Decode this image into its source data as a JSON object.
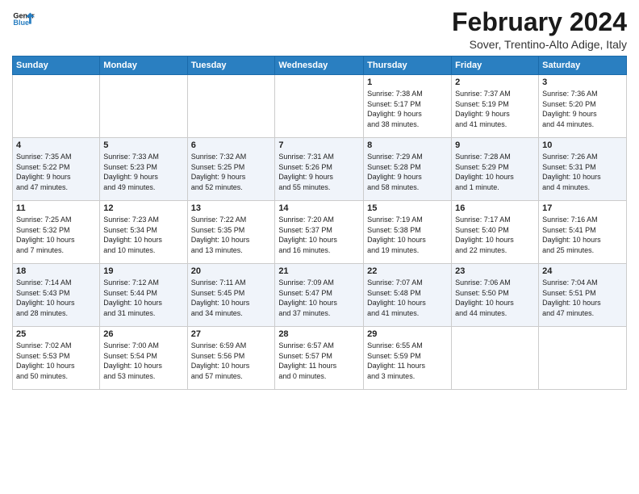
{
  "header": {
    "logo_line1": "General",
    "logo_line2": "Blue",
    "title": "February 2024",
    "subtitle": "Sover, Trentino-Alto Adige, Italy"
  },
  "days_of_week": [
    "Sunday",
    "Monday",
    "Tuesday",
    "Wednesday",
    "Thursday",
    "Friday",
    "Saturday"
  ],
  "weeks": [
    [
      {
        "day": "",
        "info": ""
      },
      {
        "day": "",
        "info": ""
      },
      {
        "day": "",
        "info": ""
      },
      {
        "day": "",
        "info": ""
      },
      {
        "day": "1",
        "info": "Sunrise: 7:38 AM\nSunset: 5:17 PM\nDaylight: 9 hours\nand 38 minutes."
      },
      {
        "day": "2",
        "info": "Sunrise: 7:37 AM\nSunset: 5:19 PM\nDaylight: 9 hours\nand 41 minutes."
      },
      {
        "day": "3",
        "info": "Sunrise: 7:36 AM\nSunset: 5:20 PM\nDaylight: 9 hours\nand 44 minutes."
      }
    ],
    [
      {
        "day": "4",
        "info": "Sunrise: 7:35 AM\nSunset: 5:22 PM\nDaylight: 9 hours\nand 47 minutes."
      },
      {
        "day": "5",
        "info": "Sunrise: 7:33 AM\nSunset: 5:23 PM\nDaylight: 9 hours\nand 49 minutes."
      },
      {
        "day": "6",
        "info": "Sunrise: 7:32 AM\nSunset: 5:25 PM\nDaylight: 9 hours\nand 52 minutes."
      },
      {
        "day": "7",
        "info": "Sunrise: 7:31 AM\nSunset: 5:26 PM\nDaylight: 9 hours\nand 55 minutes."
      },
      {
        "day": "8",
        "info": "Sunrise: 7:29 AM\nSunset: 5:28 PM\nDaylight: 9 hours\nand 58 minutes."
      },
      {
        "day": "9",
        "info": "Sunrise: 7:28 AM\nSunset: 5:29 PM\nDaylight: 10 hours\nand 1 minute."
      },
      {
        "day": "10",
        "info": "Sunrise: 7:26 AM\nSunset: 5:31 PM\nDaylight: 10 hours\nand 4 minutes."
      }
    ],
    [
      {
        "day": "11",
        "info": "Sunrise: 7:25 AM\nSunset: 5:32 PM\nDaylight: 10 hours\nand 7 minutes."
      },
      {
        "day": "12",
        "info": "Sunrise: 7:23 AM\nSunset: 5:34 PM\nDaylight: 10 hours\nand 10 minutes."
      },
      {
        "day": "13",
        "info": "Sunrise: 7:22 AM\nSunset: 5:35 PM\nDaylight: 10 hours\nand 13 minutes."
      },
      {
        "day": "14",
        "info": "Sunrise: 7:20 AM\nSunset: 5:37 PM\nDaylight: 10 hours\nand 16 minutes."
      },
      {
        "day": "15",
        "info": "Sunrise: 7:19 AM\nSunset: 5:38 PM\nDaylight: 10 hours\nand 19 minutes."
      },
      {
        "day": "16",
        "info": "Sunrise: 7:17 AM\nSunset: 5:40 PM\nDaylight: 10 hours\nand 22 minutes."
      },
      {
        "day": "17",
        "info": "Sunrise: 7:16 AM\nSunset: 5:41 PM\nDaylight: 10 hours\nand 25 minutes."
      }
    ],
    [
      {
        "day": "18",
        "info": "Sunrise: 7:14 AM\nSunset: 5:43 PM\nDaylight: 10 hours\nand 28 minutes."
      },
      {
        "day": "19",
        "info": "Sunrise: 7:12 AM\nSunset: 5:44 PM\nDaylight: 10 hours\nand 31 minutes."
      },
      {
        "day": "20",
        "info": "Sunrise: 7:11 AM\nSunset: 5:45 PM\nDaylight: 10 hours\nand 34 minutes."
      },
      {
        "day": "21",
        "info": "Sunrise: 7:09 AM\nSunset: 5:47 PM\nDaylight: 10 hours\nand 37 minutes."
      },
      {
        "day": "22",
        "info": "Sunrise: 7:07 AM\nSunset: 5:48 PM\nDaylight: 10 hours\nand 41 minutes."
      },
      {
        "day": "23",
        "info": "Sunrise: 7:06 AM\nSunset: 5:50 PM\nDaylight: 10 hours\nand 44 minutes."
      },
      {
        "day": "24",
        "info": "Sunrise: 7:04 AM\nSunset: 5:51 PM\nDaylight: 10 hours\nand 47 minutes."
      }
    ],
    [
      {
        "day": "25",
        "info": "Sunrise: 7:02 AM\nSunset: 5:53 PM\nDaylight: 10 hours\nand 50 minutes."
      },
      {
        "day": "26",
        "info": "Sunrise: 7:00 AM\nSunset: 5:54 PM\nDaylight: 10 hours\nand 53 minutes."
      },
      {
        "day": "27",
        "info": "Sunrise: 6:59 AM\nSunset: 5:56 PM\nDaylight: 10 hours\nand 57 minutes."
      },
      {
        "day": "28",
        "info": "Sunrise: 6:57 AM\nSunset: 5:57 PM\nDaylight: 11 hours\nand 0 minutes."
      },
      {
        "day": "29",
        "info": "Sunrise: 6:55 AM\nSunset: 5:59 PM\nDaylight: 11 hours\nand 3 minutes."
      },
      {
        "day": "",
        "info": ""
      },
      {
        "day": "",
        "info": ""
      }
    ]
  ]
}
